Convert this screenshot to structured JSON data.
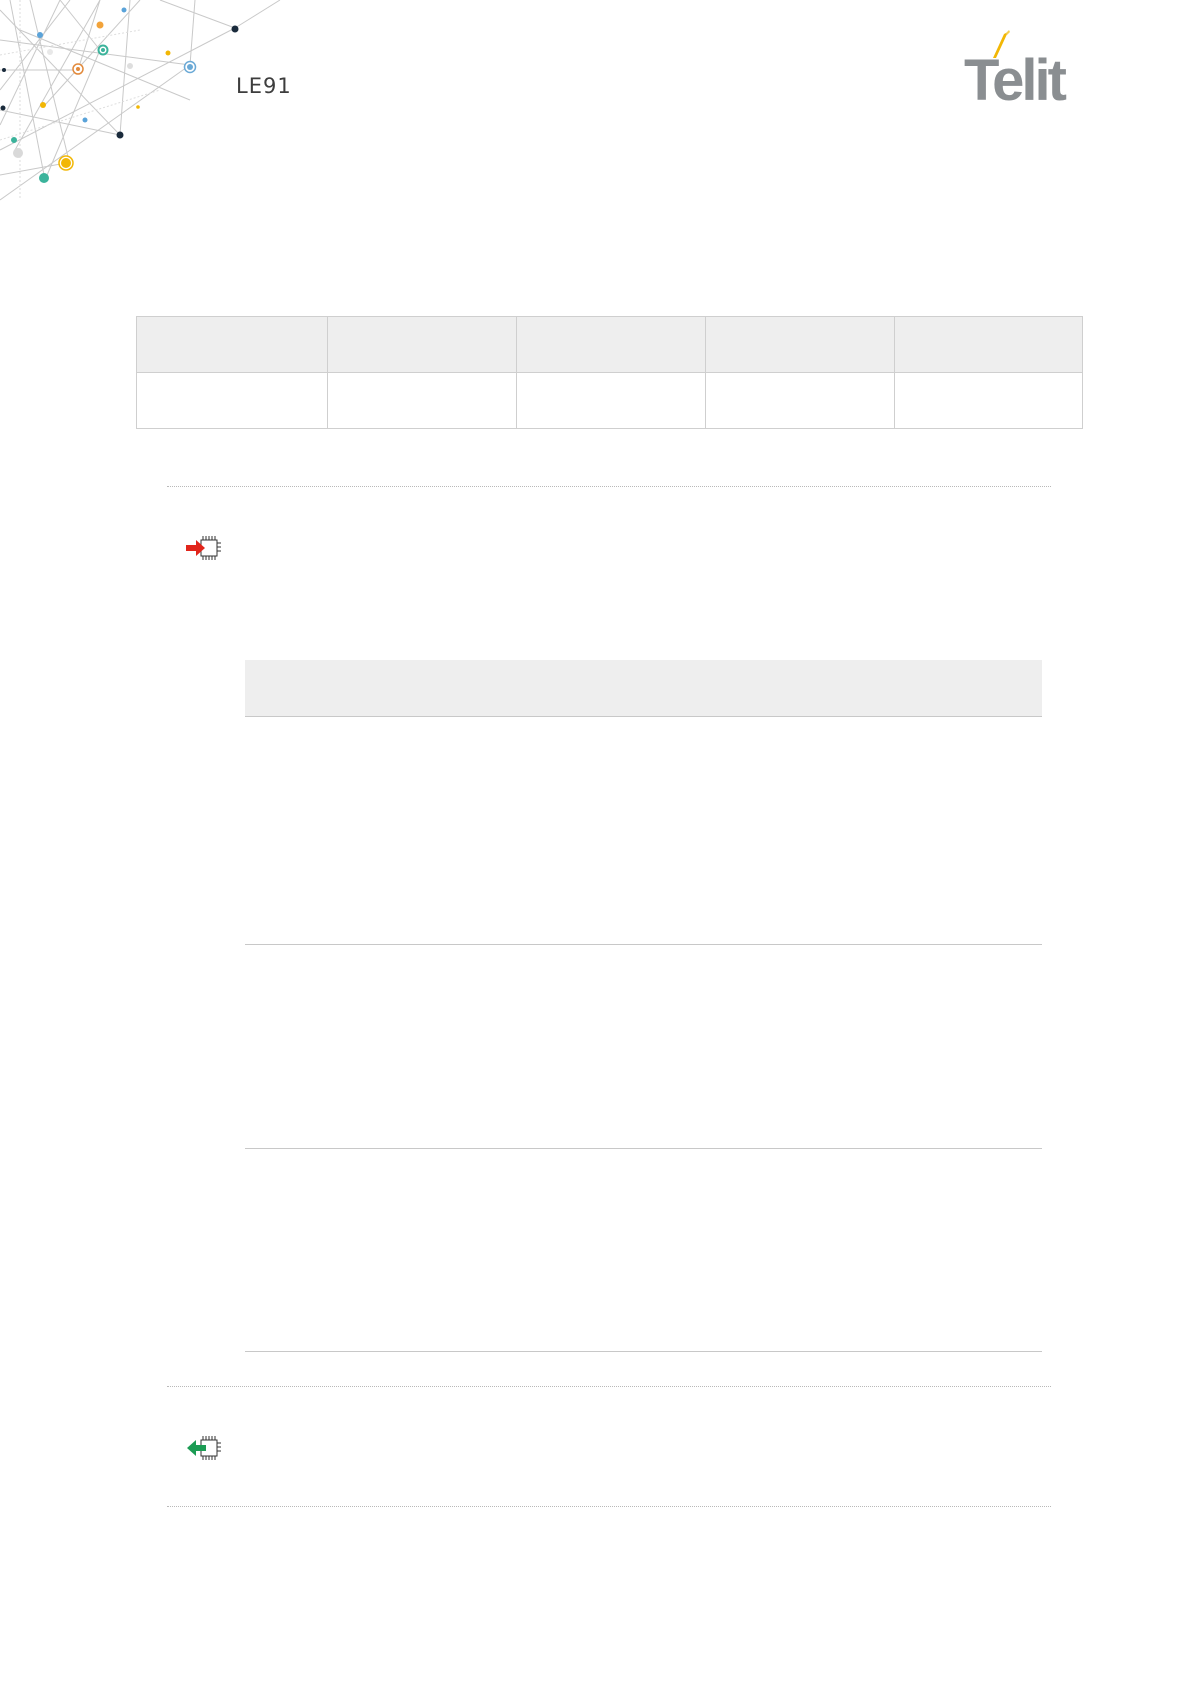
{
  "header": {
    "product": "LE91",
    "logo_text": "Telit",
    "logo_color": "#8a8e91",
    "logo_accent_color": "#f2b705"
  },
  "icons": {
    "set_command": "red-arrow-into-chip-icon",
    "read_command": "green-arrow-out-of-chip-icon",
    "red": "#e1251b",
    "green": "#1c9c54"
  },
  "grid_table": {
    "columns": 5,
    "rows": 2
  },
  "param_table": {
    "rows": 3
  }
}
